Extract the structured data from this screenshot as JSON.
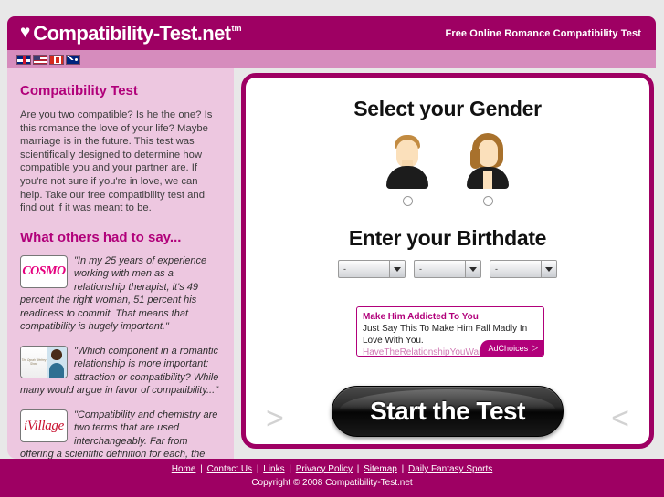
{
  "header": {
    "logo_text": "Compatibility-Test.net",
    "logo_tm": "tm",
    "heart_icon": "heart-icon",
    "tagline": "Free Online Romance Compatibility Test"
  },
  "flags": [
    {
      "name": "flag-uk",
      "label": "United Kingdom"
    },
    {
      "name": "flag-us",
      "label": "United States"
    },
    {
      "name": "flag-ca",
      "label": "Canada"
    },
    {
      "name": "flag-au",
      "label": "Australia"
    }
  ],
  "sidebar": {
    "heading": "Compatibility Test",
    "intro": "Are you two compatible? Is he the one? Is this romance the love of your life? Maybe marriage is in the future. This test was scientifically designed to determine how compatible you and your partner are. If you're not sure if you're in love, we can help. Take our free compatibility test and find out if it was meant to be.",
    "testimonials_heading": "What others had to say...",
    "testimonials": [
      {
        "logo": "COSMO",
        "quote": "\"In my 25 years of experience working with men as a relationship therapist, it's 49 percent the right woman, 51 percent his readiness to commit. That means that compatibility is hugely important.\""
      },
      {
        "logo": "The Oprah Winfrey Show",
        "quote": "\"Which component in a romantic relationship is more important: attraction or compatibility? While many would argue in favor of compatibility...\""
      },
      {
        "logo": "iVillage",
        "quote": "\"Compatibility and chemistry are two terms that are used interchangeably. Far from offering a scientific definition for each, the former entails a psychological bond between two people whereas the latter signals a"
      }
    ]
  },
  "main": {
    "gender_heading": "Select your Gender",
    "genders": [
      {
        "name": "male",
        "icon": "male-avatar-icon"
      },
      {
        "name": "female",
        "icon": "female-avatar-icon"
      }
    ],
    "birthdate_heading": "Enter your Birthdate",
    "birthdate_selects": [
      {
        "name": "month",
        "value": "-"
      },
      {
        "name": "day",
        "value": "-"
      },
      {
        "name": "year",
        "value": "-"
      }
    ],
    "start_button": "Start the Test",
    "arrow_left": ">",
    "arrow_right": "<"
  },
  "ad": {
    "title": "Make Him Addicted To You",
    "body": "Just Say This To Make Him Fall Madly In Love With You.",
    "url": "HaveTheRelationshipYouWant",
    "adchoices_label": "AdChoices",
    "adchoices_icon": "triangle-right-icon"
  },
  "footer": {
    "links": [
      "Home",
      "Contact Us",
      "Links",
      "Privacy Policy",
      "Sitemap",
      "Daily Fantasy Sports"
    ],
    "separator": "|",
    "copyright": "Copyright © 2008 Compatibility-Test.net"
  },
  "colors": {
    "brand_magenta": "#9e0063",
    "brand_pink": "#b1007a",
    "sidebar_bg": "#edc7e0",
    "flagbar_bg": "#d68cbd",
    "page_bg": "#e8e8e8"
  }
}
